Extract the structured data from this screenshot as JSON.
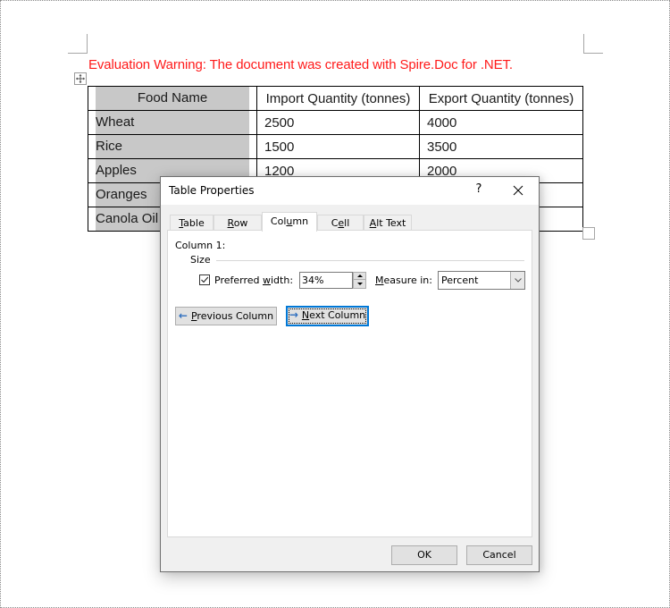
{
  "document": {
    "warning": "Evaluation Warning: The document was created with Spire.Doc for .NET.",
    "table": {
      "headers": [
        "Food Name",
        "Import Quantity (tonnes)",
        "Export Quantity (tonnes)"
      ],
      "rows": [
        [
          "Wheat",
          "2500",
          "4000"
        ],
        [
          "Rice",
          "1500",
          "3500"
        ],
        [
          "Apples",
          "1200",
          "2000"
        ],
        [
          "Oranges",
          "",
          ""
        ],
        [
          "Canola Oil",
          "",
          ""
        ]
      ]
    }
  },
  "dialog": {
    "title": "Table Properties",
    "help": "?",
    "tabs": [
      {
        "pre": "",
        "u": "T",
        "post": "able"
      },
      {
        "pre": "",
        "u": "R",
        "post": "ow"
      },
      {
        "pre": "Col",
        "u": "u",
        "post": "mn"
      },
      {
        "pre": "C",
        "u": "e",
        "post": "ll"
      },
      {
        "pre": "",
        "u": "A",
        "post": "lt Text"
      }
    ],
    "active_tab": "Column",
    "column_label": "Column 1:",
    "size_label": "Size",
    "preferred_width": {
      "checked": true,
      "label_pre": "Preferred ",
      "label_u": "w",
      "label_post": "idth:",
      "value": "34%"
    },
    "measure_in": {
      "label_u": "M",
      "label_post": "easure in:",
      "value": "Percent"
    },
    "prev_button": {
      "u": "P",
      "post": "revious Column"
    },
    "next_button": {
      "u": "N",
      "post": "ext Column"
    },
    "ok_label": "OK",
    "cancel_label": "Cancel"
  },
  "colors": {
    "warning": "#ff1a1a",
    "focus": "#0078d7",
    "header_shade": "#c8c8c8"
  }
}
